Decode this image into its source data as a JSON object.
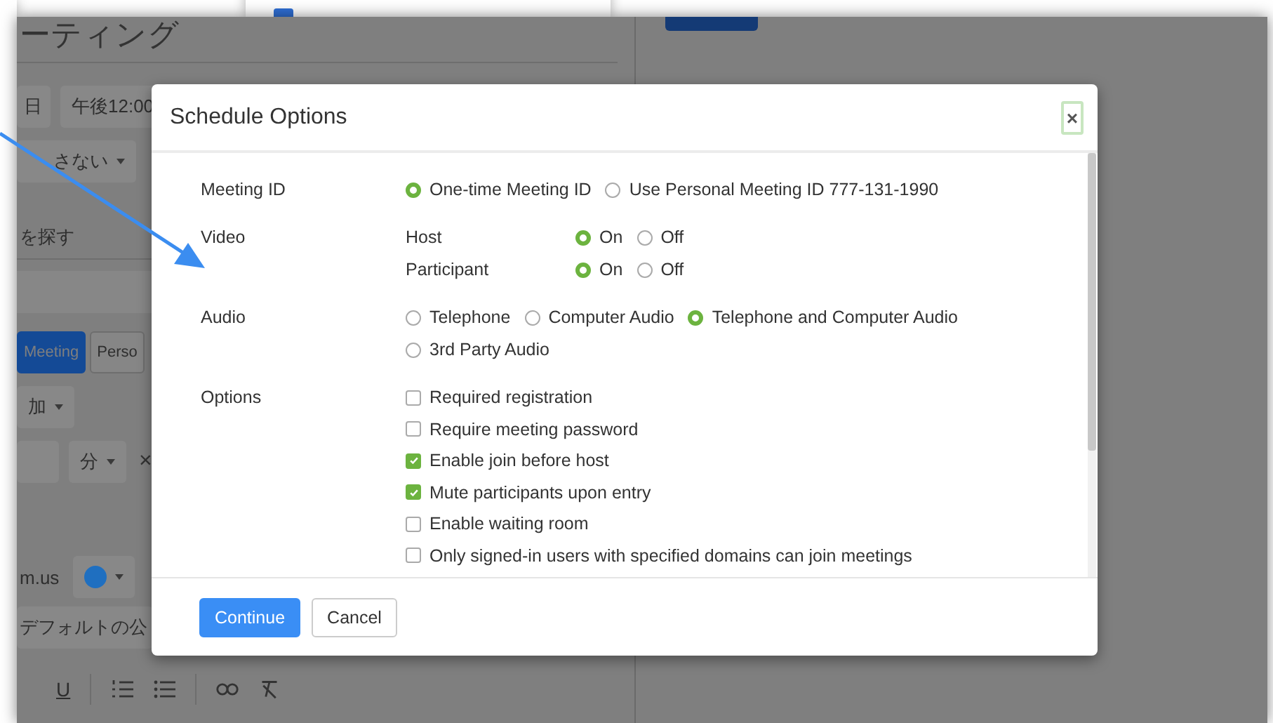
{
  "background": {
    "heading": "ーティング",
    "date": "日",
    "time": "午後12:00",
    "recurrence": "さない",
    "find_time": "を探す",
    "tabs": [
      {
        "label": "Meeting",
        "selected": true
      },
      {
        "label": "Perso",
        "selected": false
      }
    ],
    "guests": "加",
    "unit": "分",
    "remove": "×",
    "calendar": {
      "name": "m.us",
      "color": "#1f6fc0"
    },
    "visibility": "デフォルトの公",
    "underline": "U"
  },
  "dialog": {
    "title": "Schedule Options",
    "close": "×",
    "sections": [
      {
        "label": "Meeting ID",
        "kind": "radios",
        "options": [
          {
            "label": "One-time Meeting ID",
            "selected": true
          },
          {
            "label": "Use Personal Meeting ID 777-131-1990",
            "selected": false
          }
        ]
      },
      {
        "label": "Video",
        "kind": "subradios",
        "rows": [
          {
            "label": "Host",
            "options": [
              {
                "label": "On",
                "selected": true
              },
              {
                "label": "Off",
                "selected": false
              }
            ]
          },
          {
            "label": "Participant",
            "options": [
              {
                "label": "On",
                "selected": true
              },
              {
                "label": "Off",
                "selected": false
              }
            ]
          }
        ]
      },
      {
        "label": "Audio",
        "kind": "radios",
        "options": [
          {
            "label": "Telephone",
            "selected": false
          },
          {
            "label": "Computer Audio",
            "selected": false
          },
          {
            "label": "Telephone and Computer Audio",
            "selected": true
          },
          {
            "label": "3rd Party Audio",
            "selected": false
          }
        ]
      },
      {
        "label": "Options",
        "kind": "checkboxes",
        "options": [
          {
            "label": "Required registration",
            "checked": false
          },
          {
            "label": "Require meeting password",
            "checked": false
          },
          {
            "label": "Enable join before host",
            "checked": true
          },
          {
            "label": "Mute participants upon entry",
            "checked": true
          },
          {
            "label": "Enable waiting room",
            "checked": false
          },
          {
            "label": "Only signed-in users with specified domains can join meetings",
            "checked": false
          }
        ]
      }
    ],
    "buttons": [
      {
        "label": "Continue",
        "kind": "primary"
      },
      {
        "label": "Cancel",
        "kind": "default"
      }
    ]
  }
}
